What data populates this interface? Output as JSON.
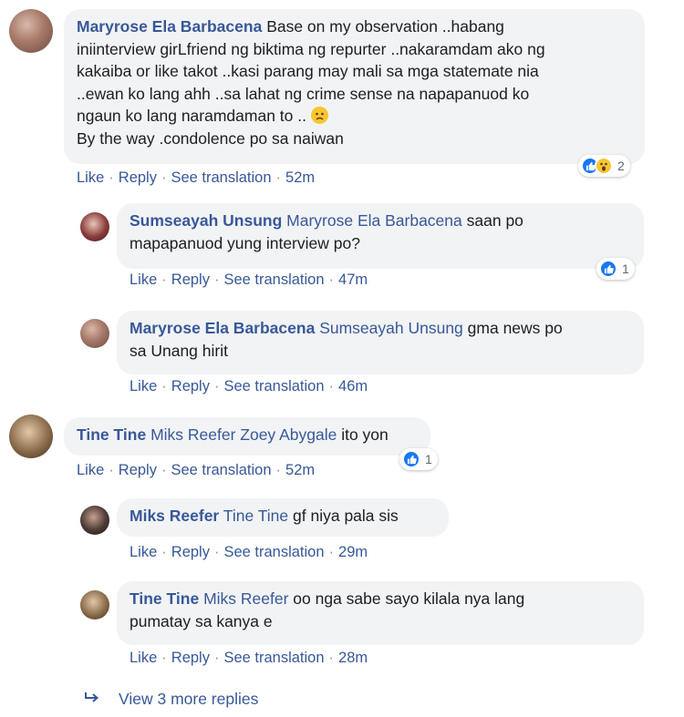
{
  "comments": [
    {
      "author": "Maryrose Ela Barbacena",
      "mention": "",
      "text_lines": [
        "Base on my observation ..habang",
        "iniinterview girLfriend ng biktima ng repurter ..nakaramdam ako ng",
        "kakaiba or like takot ..kasi parang may mali sa mga statemate nia",
        "..ewan ko lang ahh ..sa lahat ng crime sense na napapanuod ko",
        "ngaun ko lang naramdaman to ..",
        "By the way .condolence po sa naiwan"
      ],
      "emoji": "sad-face",
      "actions": {
        "like": "Like",
        "reply": "Reply",
        "translate": "See translation",
        "time": "52m"
      },
      "reactions": {
        "icons": [
          "like",
          "wow"
        ],
        "count": "2"
      }
    }
  ],
  "replies_1": [
    {
      "author": "Sumseayah Unsung",
      "mention": "Maryrose Ela Barbacena",
      "text": "saan po",
      "text2": "mapapanuod yung interview po?",
      "actions": {
        "like": "Like",
        "reply": "Reply",
        "translate": "See translation",
        "time": "47m"
      },
      "reactions": {
        "icons": [
          "like"
        ],
        "count": "1"
      }
    },
    {
      "author": "Maryrose Ela Barbacena",
      "mention": "Sumseayah Unsung",
      "text": "gma news po",
      "text2": "sa Unang hirit",
      "actions": {
        "like": "Like",
        "reply": "Reply",
        "translate": "See translation",
        "time": "46m"
      }
    }
  ],
  "comment2": {
    "author": "Tine Tine",
    "mention": "Miks Reefer Zoey Abygale",
    "text": "ito yon",
    "actions": {
      "like": "Like",
      "reply": "Reply",
      "translate": "See translation",
      "time": "52m"
    },
    "reactions": {
      "icons": [
        "like"
      ],
      "count": "1"
    }
  },
  "replies_2": [
    {
      "author": "Miks Reefer",
      "mention": "Tine Tine",
      "text": "gf niya pala sis",
      "actions": {
        "like": "Like",
        "reply": "Reply",
        "translate": "See translation",
        "time": "29m"
      }
    },
    {
      "author": "Tine Tine",
      "mention": "Miks Reefer",
      "text": "oo nga sabe sayo kilala nya lang",
      "text2": "pumatay sa kanya e",
      "actions": {
        "like": "Like",
        "reply": "Reply",
        "translate": "See translation",
        "time": "28m"
      }
    }
  ],
  "view_more": "View 3 more replies",
  "colors": {
    "link": "#385898",
    "bubble": "#f2f3f5",
    "like_blue": "#1877f2",
    "wow_yellow": "#f7c52f"
  }
}
